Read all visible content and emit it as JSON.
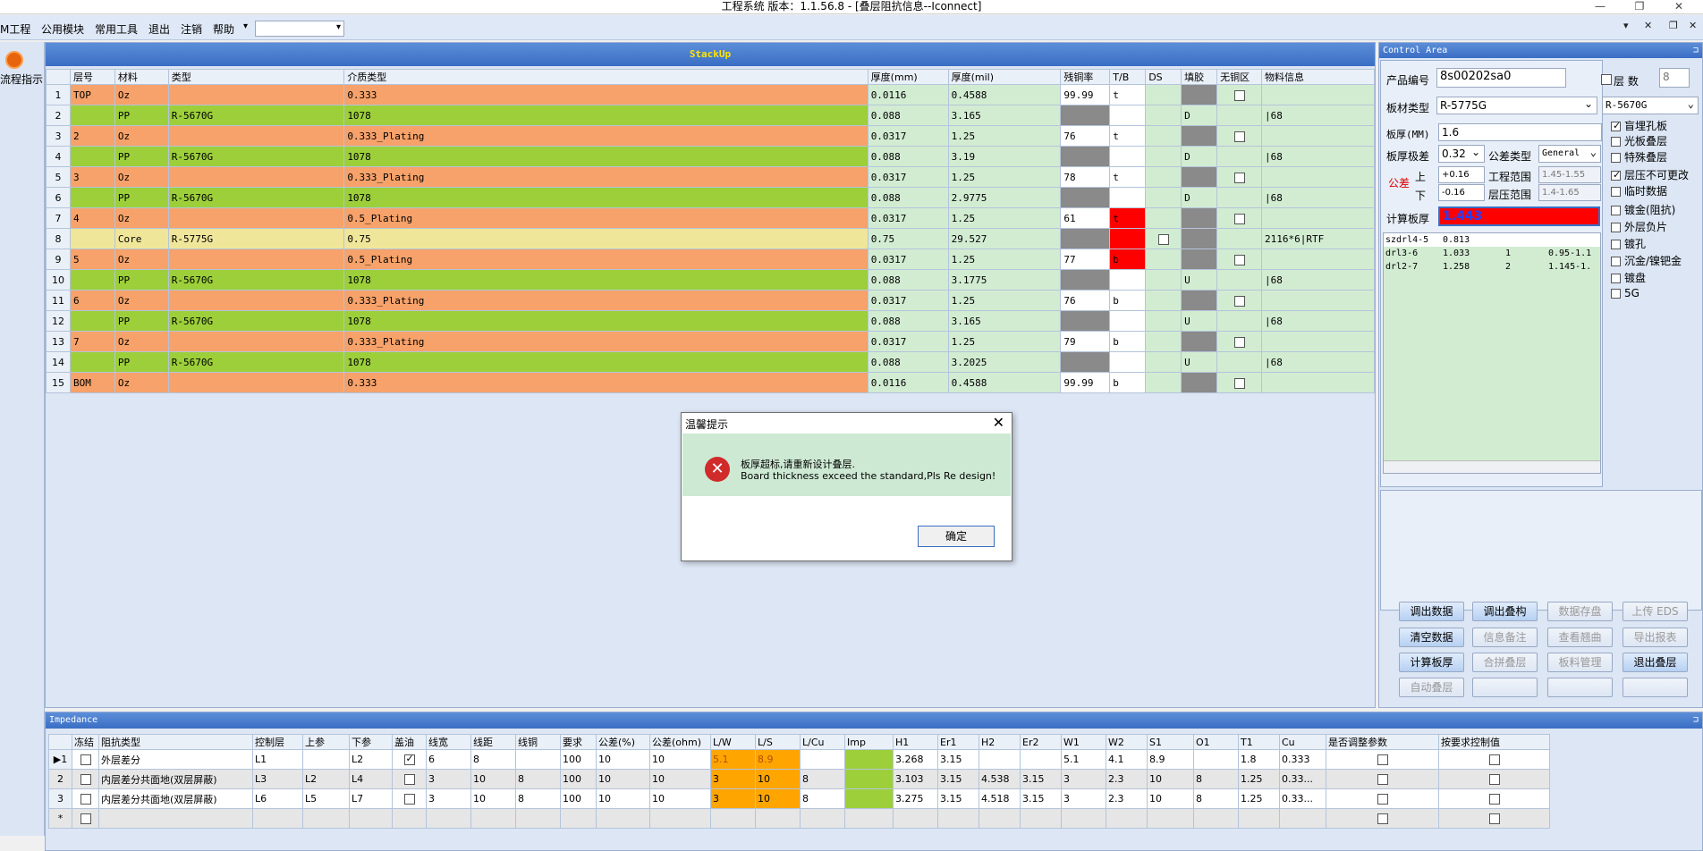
{
  "window": {
    "title": "工程系统   版本：1.1.56.8 - [叠层阻抗信息--Iconnect]",
    "minimize": "—",
    "restore": "❐",
    "close": "✕"
  },
  "menu": {
    "items": [
      "M工程",
      "公用模块",
      "常用工具",
      "退出",
      "注销",
      "帮助",
      "▾"
    ],
    "combo_value": ""
  },
  "mdi_buttons": [
    "▾",
    "✕",
    "❐",
    "✕"
  ],
  "left_pane": {
    "label": "流程指示"
  },
  "stackup": {
    "title": "StackUp",
    "columns": [
      "",
      "层号",
      "材料",
      "类型",
      "介质类型",
      "厚度(mm)",
      "厚度(mil)",
      "残铜率",
      "T/B",
      "DS",
      "填胶",
      "无铜区",
      "物料信息"
    ],
    "rows": [
      {
        "n": "1",
        "layer": "TOP",
        "mat": "Oz",
        "type": "",
        "dielectric": "0.333",
        "mm": "0.0116",
        "mil": "0.4588",
        "copper": "99.99",
        "tb": "t",
        "ds": "",
        "fill": "",
        "nocu": true,
        "info": "",
        "kind": "cu"
      },
      {
        "n": "2",
        "layer": "",
        "mat": "PP",
        "type": "R-5670G",
        "dielectric": "1078",
        "mm": "0.088",
        "mil": "3.165",
        "copper": "",
        "tb": "",
        "ds": "",
        "fill": "D",
        "nocu": false,
        "info": "|68",
        "kind": "pp"
      },
      {
        "n": "3",
        "layer": "2",
        "mat": "Oz",
        "type": "",
        "dielectric": "0.333_Plating",
        "mm": "0.0317",
        "mil": "1.25",
        "copper": "76",
        "tb": "t",
        "ds": "",
        "fill": "",
        "nocu": true,
        "info": "",
        "kind": "cu"
      },
      {
        "n": "4",
        "layer": "",
        "mat": "PP",
        "type": "R-5670G",
        "dielectric": "1078",
        "mm": "0.088",
        "mil": "3.19",
        "copper": "",
        "tb": "",
        "ds": "",
        "fill": "D",
        "nocu": false,
        "info": "|68",
        "kind": "pp"
      },
      {
        "n": "5",
        "layer": "3",
        "mat": "Oz",
        "type": "",
        "dielectric": "0.333_Plating",
        "mm": "0.0317",
        "mil": "1.25",
        "copper": "78",
        "tb": "t",
        "ds": "",
        "fill": "",
        "nocu": true,
        "info": "",
        "kind": "cu"
      },
      {
        "n": "6",
        "layer": "",
        "mat": "PP",
        "type": "R-5670G",
        "dielectric": "1078",
        "mm": "0.088",
        "mil": "2.9775",
        "copper": "",
        "tb": "",
        "ds": "",
        "fill": "D",
        "nocu": false,
        "info": "|68",
        "kind": "pp"
      },
      {
        "n": "7",
        "layer": "4",
        "mat": "Oz",
        "type": "",
        "dielectric": "0.5_Plating",
        "mm": "0.0317",
        "mil": "1.25",
        "copper": "61",
        "tb": "t",
        "ds": "",
        "fill": "",
        "nocu": true,
        "info": "",
        "kind": "cu",
        "tbred": true
      },
      {
        "n": "8",
        "layer": "",
        "mat": "Core",
        "type": "R-5775G",
        "dielectric": "0.75",
        "mm": "0.75",
        "mil": "29.527",
        "copper": "",
        "tb": "",
        "ds": "cb",
        "fill": "",
        "nocu": false,
        "info": "2116*6|RTF",
        "kind": "core",
        "tbred": true
      },
      {
        "n": "9",
        "layer": "5",
        "mat": "Oz",
        "type": "",
        "dielectric": "0.5_Plating",
        "mm": "0.0317",
        "mil": "1.25",
        "copper": "77",
        "tb": "b",
        "ds": "",
        "fill": "",
        "nocu": true,
        "info": "",
        "kind": "cu",
        "tbred": true
      },
      {
        "n": "10",
        "layer": "",
        "mat": "PP",
        "type": "R-5670G",
        "dielectric": "1078",
        "mm": "0.088",
        "mil": "3.1775",
        "copper": "",
        "tb": "",
        "ds": "",
        "fill": "U",
        "nocu": false,
        "info": "|68",
        "kind": "pp"
      },
      {
        "n": "11",
        "layer": "6",
        "mat": "Oz",
        "type": "",
        "dielectric": "0.333_Plating",
        "mm": "0.0317",
        "mil": "1.25",
        "copper": "76",
        "tb": "b",
        "ds": "",
        "fill": "",
        "nocu": true,
        "info": "",
        "kind": "cu"
      },
      {
        "n": "12",
        "layer": "",
        "mat": "PP",
        "type": "R-5670G",
        "dielectric": "1078",
        "mm": "0.088",
        "mil": "3.165",
        "copper": "",
        "tb": "",
        "ds": "",
        "fill": "U",
        "nocu": false,
        "info": "|68",
        "kind": "pp"
      },
      {
        "n": "13",
        "layer": "7",
        "mat": "Oz",
        "type": "",
        "dielectric": "0.333_Plating",
        "mm": "0.0317",
        "mil": "1.25",
        "copper": "79",
        "tb": "b",
        "ds": "",
        "fill": "",
        "nocu": true,
        "info": "",
        "kind": "cu"
      },
      {
        "n": "14",
        "layer": "",
        "mat": "PP",
        "type": "R-5670G",
        "dielectric": "1078",
        "mm": "0.088",
        "mil": "3.2025",
        "copper": "",
        "tb": "",
        "ds": "",
        "fill": "U",
        "nocu": false,
        "info": "|68",
        "kind": "pp"
      },
      {
        "n": "15",
        "layer": "BOM",
        "mat": "Oz",
        "type": "",
        "dielectric": "0.333",
        "mm": "0.0116",
        "mil": "0.4588",
        "copper": "99.99",
        "tb": "b",
        "ds": "",
        "fill": "",
        "nocu": true,
        "info": "",
        "kind": "cu"
      }
    ]
  },
  "control": {
    "title": "Control Area",
    "pin": "⊐",
    "product_label": "产品编号",
    "product_value": "8s00202sa0",
    "layers_label": "层 数",
    "layers_value": "8",
    "board_label": "板材类型",
    "board_value1": "R-5775G",
    "board_value2": "R-5670G",
    "thk_label": "板厚(MM)",
    "thk_value": "1.6",
    "thk_tol_label": "板厚极差",
    "thk_tol_value": "0.32",
    "tol_type_label": "公差类型",
    "tol_type_value": "General",
    "tol_label": "公差",
    "up_label": "上",
    "up_value": "+0.16",
    "down_label": "下",
    "down_value": "-0.16",
    "proj_range_label": "工程范围",
    "proj_range_value": "1.45-1.55",
    "press_range_label": "层压范围",
    "press_range_value": "1.4-1.65",
    "calc_label": "计算板厚",
    "calc_value": "1.443",
    "grid_rows": [
      [
        "szdrl4-5",
        "0.813",
        "",
        ""
      ],
      [
        "drl3-6",
        "1.033",
        "1",
        "0.95-1.1"
      ],
      [
        "drl2-7",
        "1.258",
        "2",
        "1.145-1."
      ]
    ],
    "checks": [
      {
        "label": "盲埋孔板",
        "checked": true,
        "enabled": true
      },
      {
        "label": "光板叠层",
        "checked": false,
        "enabled": true
      },
      {
        "label": "特殊叠层",
        "checked": false,
        "enabled": true
      },
      {
        "label": "层压不可更改",
        "checked": true,
        "enabled": true
      },
      {
        "label": "临时数据",
        "checked": false,
        "enabled": true
      },
      {
        "label": "镀金(阻抗)",
        "checked": false,
        "enabled": true
      },
      {
        "label": "外层负片",
        "checked": false,
        "enabled": true
      },
      {
        "label": "镀孔",
        "checked": false,
        "enabled": true
      },
      {
        "label": "沉金/镍钯金",
        "checked": false,
        "enabled": true
      },
      {
        "label": "镀盘",
        "checked": false,
        "enabled": true
      },
      {
        "label": "5G",
        "checked": false,
        "enabled": true
      }
    ],
    "buttons": [
      [
        "调出数据",
        "调出叠构",
        "数据存盘",
        "上传 EDS"
      ],
      [
        "清空数据",
        "信息备注",
        "查看翘曲",
        "导出报表"
      ],
      [
        "计算板厚",
        "合拼叠层",
        "板料管理",
        "退出叠层"
      ],
      [
        "自动叠层",
        "",
        "",
        ""
      ]
    ],
    "buttons_enabled": [
      [
        true,
        true,
        false,
        false
      ],
      [
        true,
        false,
        false,
        false
      ],
      [
        true,
        false,
        false,
        true
      ],
      [
        false,
        false,
        false,
        false
      ]
    ]
  },
  "impedance": {
    "title": "Impedance",
    "columns": [
      "",
      "冻结",
      "阻抗类型",
      "控制层",
      "上参",
      "下参",
      "盖油",
      "线宽",
      "线距",
      "线铜",
      "要求",
      "公差(%)",
      "公差(ohm)",
      "L/W",
      "L/S",
      "L/Cu",
      "Imp",
      "H1",
      "Er1",
      "H2",
      "Er2",
      "W1",
      "W2",
      "S1",
      "O1",
      "T1",
      "Cu",
      "是否调整参数",
      "按要求控制值"
    ],
    "rows": [
      {
        "n": "▶1",
        "type": "外层差分",
        "ctrl": "L1",
        "up": "",
        "down": "L2",
        "oil": true,
        "lw": "6",
        "ls": "8",
        "lcu": "",
        "req": "100",
        "tolp": "10",
        "tolo": "10",
        "LW": "5.1",
        "LS": "8.9",
        "LCu": "",
        "H1": "3.268",
        "Er1": "3.15",
        "H2": "",
        "Er2": "",
        "W1": "5.1",
        "W2": "4.1",
        "S1": "8.9",
        "O1": "",
        "T1": "1.8",
        "Cu": "0.333"
      },
      {
        "n": "2",
        "type": "内层差分共面地(双层屏蔽)",
        "ctrl": "L3",
        "up": "L2",
        "down": "L4",
        "oil": false,
        "lw": "3",
        "ls": "10",
        "lcu": "8",
        "req": "100",
        "tolp": "10",
        "tolo": "10",
        "LW": "3",
        "LS": "10",
        "LCu": "8",
        "H1": "3.103",
        "Er1": "3.15",
        "H2": "4.538",
        "Er2": "3.15",
        "W1": "3",
        "W2": "2.3",
        "S1": "10",
        "O1": "8",
        "T1": "1.25",
        "Cu": "0.33..."
      },
      {
        "n": "3",
        "type": "内层差分共面地(双层屏蔽)",
        "ctrl": "L6",
        "up": "L5",
        "down": "L7",
        "oil": false,
        "lw": "3",
        "ls": "10",
        "lcu": "8",
        "req": "100",
        "tolp": "10",
        "tolo": "10",
        "LW": "3",
        "LS": "10",
        "LCu": "8",
        "H1": "3.275",
        "Er1": "3.15",
        "H2": "4.518",
        "Er2": "3.15",
        "W1": "3",
        "W2": "2.3",
        "S1": "10",
        "O1": "8",
        "T1": "1.25",
        "Cu": "0.33..."
      }
    ],
    "new_row_marker": "*"
  },
  "dialog": {
    "title": "温馨提示",
    "close": "✕",
    "icon": "error-icon",
    "line1": "板厚超标,请重新设计叠层.",
    "line2": "Board thickness exceed the standard,Pls Re design!",
    "ok": "确定"
  },
  "colors": {
    "orange": "#f6a26a",
    "green": "#9ccf3a",
    "yellow": "#f0e69a",
    "red": "#ff0000",
    "gray": "#8a8a8a",
    "lightgreen": "#d2ecd2"
  }
}
